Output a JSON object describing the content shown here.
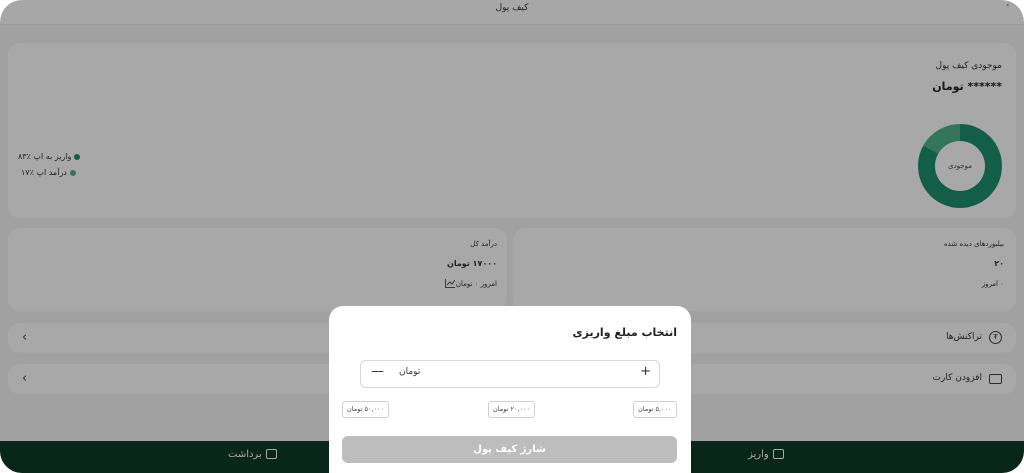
{
  "window": {
    "title": "کیف پول",
    "corner_icon": "˂"
  },
  "balance_card": {
    "title": "موجودی کیف پول",
    "masked_amount": "****** تومان",
    "donut_center_label": "موجودی",
    "legend": [
      {
        "label": "واریز به اپ ٪۸۳",
        "color": "#1d8f6b"
      },
      {
        "label": "درآمد اپ ٪۱۷",
        "color": "#4fb28e"
      }
    ]
  },
  "income_card": {
    "title": "درآمد کل",
    "value": "۱۷۰۰۰ تومان",
    "today": "امروز ۰ تومان"
  },
  "views_card": {
    "title": "بیلبوردهای دیده شده",
    "value": "۲۰",
    "today": "۰ امروز"
  },
  "rows": [
    {
      "label": "تراکنش‌ها",
      "icon": "transactions-icon"
    },
    {
      "label": "افزودن کارت",
      "icon": "credit-card-icon"
    }
  ],
  "bottom_bar": {
    "deposit_label": "واریز",
    "withdraw_label": "برداشت"
  },
  "modal": {
    "title": "انتخاب مبلغ واریزی",
    "unit": "تومان",
    "plus": "+",
    "minus": "—",
    "chips": [
      "۵,۰۰۰ تومان",
      "۲۰,۰۰۰ تومان",
      "۵۰,۰۰۰ تومان"
    ],
    "charge_button": "شارژ کیف پول"
  },
  "colors": {
    "brand_dark": "#0f3b2a",
    "accent": "#1d8f6b",
    "accent_light": "#4fb28e"
  }
}
